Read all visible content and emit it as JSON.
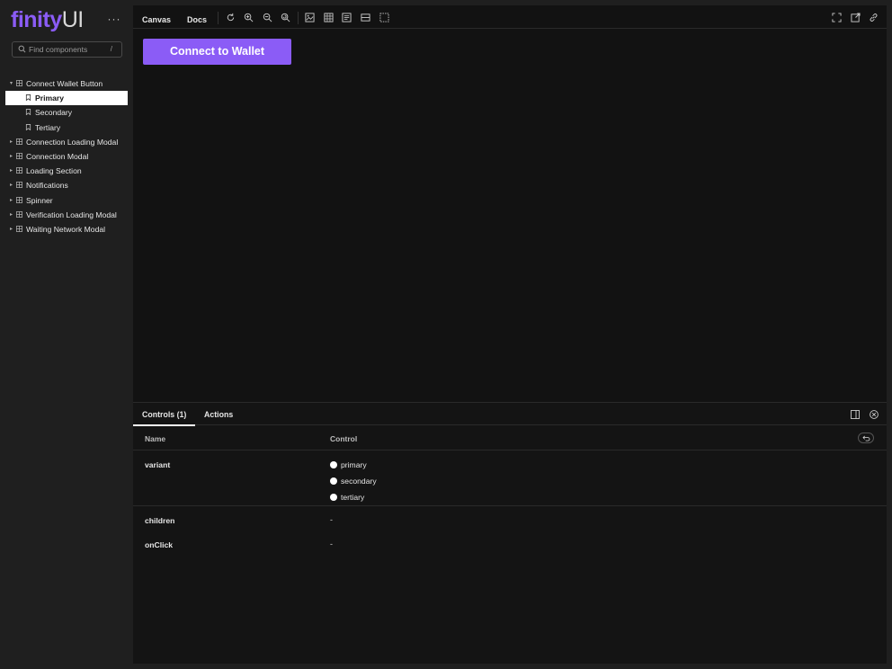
{
  "sidebar": {
    "logo": {
      "part1": "finity",
      "part2": "UI"
    },
    "menu_label": "···",
    "search": {
      "placeholder": "Find components",
      "shortcut": "/"
    },
    "tree": [
      {
        "label": "Connect Wallet Button",
        "expanded": true,
        "children": [
          {
            "label": "Primary",
            "selected": true
          },
          {
            "label": "Secondary"
          },
          {
            "label": "Tertiary"
          }
        ]
      },
      {
        "label": "Connection Loading Modal"
      },
      {
        "label": "Connection Modal"
      },
      {
        "label": "Loading Section"
      },
      {
        "label": "Notifications"
      },
      {
        "label": "Spinner"
      },
      {
        "label": "Verification Loading Modal"
      },
      {
        "label": "Waiting Network Modal"
      }
    ]
  },
  "toolbar": {
    "tabs": [
      "Canvas",
      "Docs"
    ],
    "tools": [
      "reload-icon",
      "zoom-in-icon",
      "zoom-out-icon",
      "zoom-reset-icon",
      "background-icon",
      "grid-icon",
      "measure-icon",
      "outline-icon",
      "viewport-icon"
    ],
    "right_tools": [
      "fullscreen-icon",
      "open-new-tab-icon",
      "copy-link-icon"
    ]
  },
  "canvas": {
    "button_label": "Connect to Wallet",
    "accent": "#8b5cf6"
  },
  "addons": {
    "tabs": [
      "Controls (1)",
      "Actions"
    ],
    "active_tab": "Controls (1)",
    "columns": {
      "name": "Name",
      "control": "Control"
    },
    "rows": {
      "variant": {
        "name": "variant",
        "options": [
          "primary",
          "secondary",
          "tertiary"
        ]
      },
      "children": {
        "name": "children",
        "value": "-"
      },
      "onclick": {
        "name": "onClick",
        "value": "-"
      }
    }
  }
}
